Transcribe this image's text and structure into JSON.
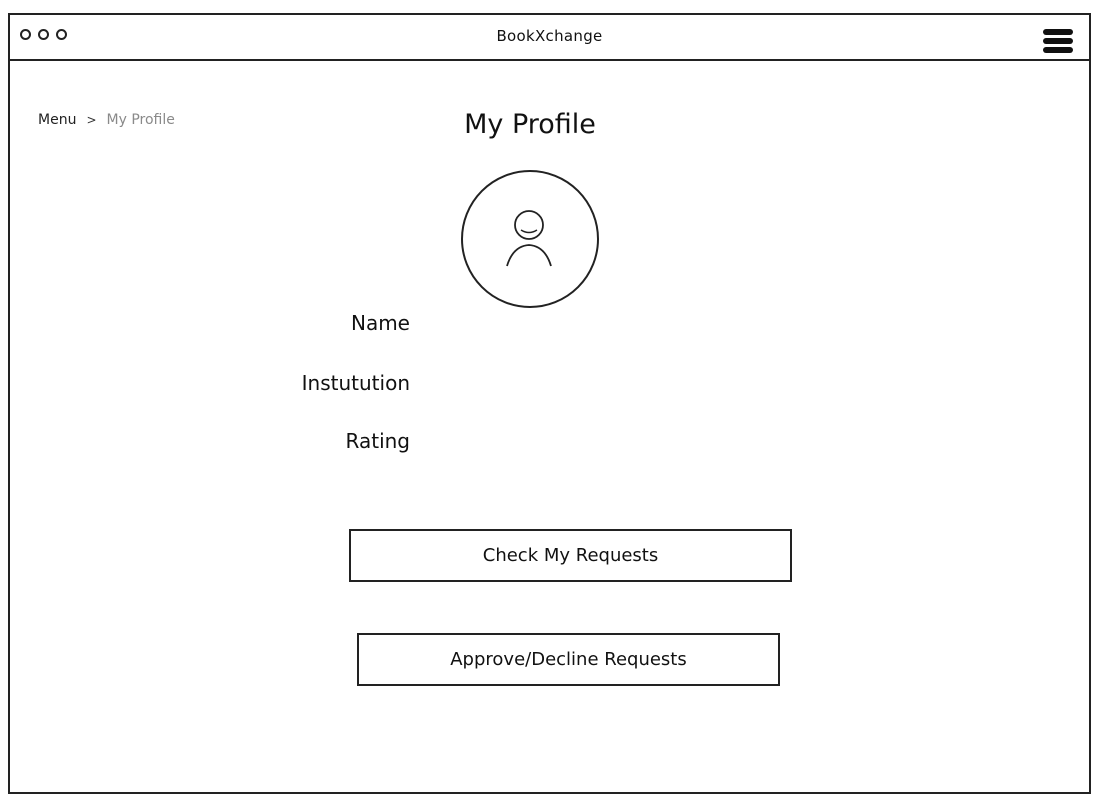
{
  "window": {
    "title": "BookXchange"
  },
  "breadcrumb": {
    "root": "Menu",
    "separator": ">",
    "current": "My Profile"
  },
  "page": {
    "title": "My Profile"
  },
  "profile": {
    "labels": {
      "name": "Name",
      "institution": "Instutution",
      "rating": "Rating"
    }
  },
  "actions": {
    "check_requests": "Check My Requests",
    "approve_decline": "Approve/Decline Requests"
  },
  "icons": {
    "menu": "hamburger-menu-icon",
    "avatar": "user-icon"
  }
}
